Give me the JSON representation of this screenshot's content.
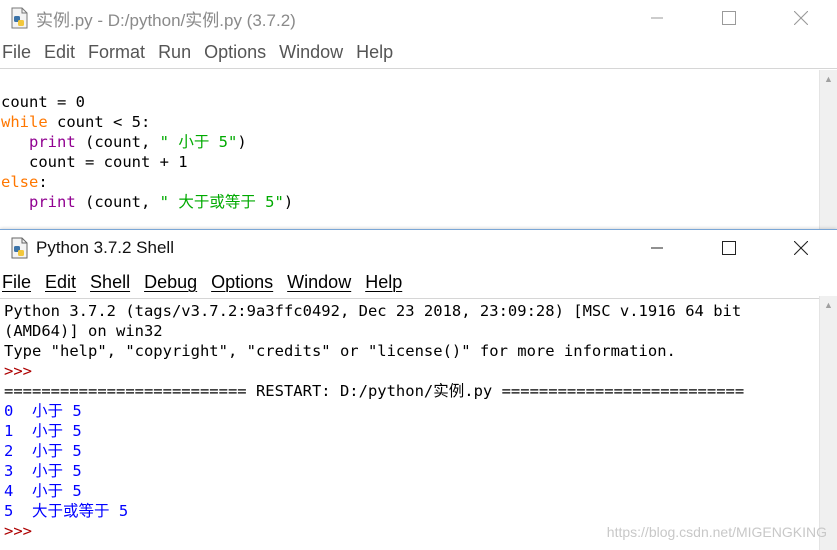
{
  "editor": {
    "title": "实例.py - D:/python/实例.py (3.7.2)",
    "menu": [
      "File",
      "Edit",
      "Format",
      "Run",
      "Options",
      "Window",
      "Help"
    ],
    "code": {
      "l1": "count = 0",
      "l2_kw": "while",
      "l2_rest": " count < 5:",
      "l3_indent": "   ",
      "l3_fn": "print",
      "l3_mid": " (count, ",
      "l3_str": "\" 小于 5\"",
      "l3_end": ")",
      "l4": "   count = count + 1",
      "l5_kw": "else",
      "l5_rest": ":",
      "l6_indent": "   ",
      "l6_fn": "print",
      "l6_mid": " (count, ",
      "l6_str": "\" 大于或等于 5\"",
      "l6_end": ")"
    }
  },
  "shell": {
    "title": "Python 3.7.2 Shell",
    "menu": [
      "File",
      "Edit",
      "Shell",
      "Debug",
      "Options",
      "Window",
      "Help"
    ],
    "banner": [
      "Python 3.7.2 (tags/v3.7.2:9a3ffc0492, Dec 23 2018, 23:09:28) [MSC v.1916 64 bit",
      "(AMD64)] on win32",
      "Type \"help\", \"copyright\", \"credits\" or \"license()\" for more information."
    ],
    "prompt": ">>>",
    "restart": "========================== RESTART: D:/python/实例.py ==========================",
    "output": [
      "0  小于 5",
      "1  小于 5",
      "2  小于 5",
      "3  小于 5",
      "4  小于 5",
      "5  大于或等于 5"
    ],
    "final_prompt": ">>>"
  },
  "watermark": "https://blog.csdn.net/MIGENGKING",
  "icons": {
    "editor_app": "python-file-icon",
    "shell_app": "python-shell-icon",
    "minimize": "minimize-icon",
    "maximize": "maximize-icon",
    "close": "close-icon"
  },
  "colors": {
    "keyword": "#ff7700",
    "builtin": "#900090",
    "string": "#00aa00",
    "output": "#0000ff",
    "prompt": "#ad0000"
  }
}
